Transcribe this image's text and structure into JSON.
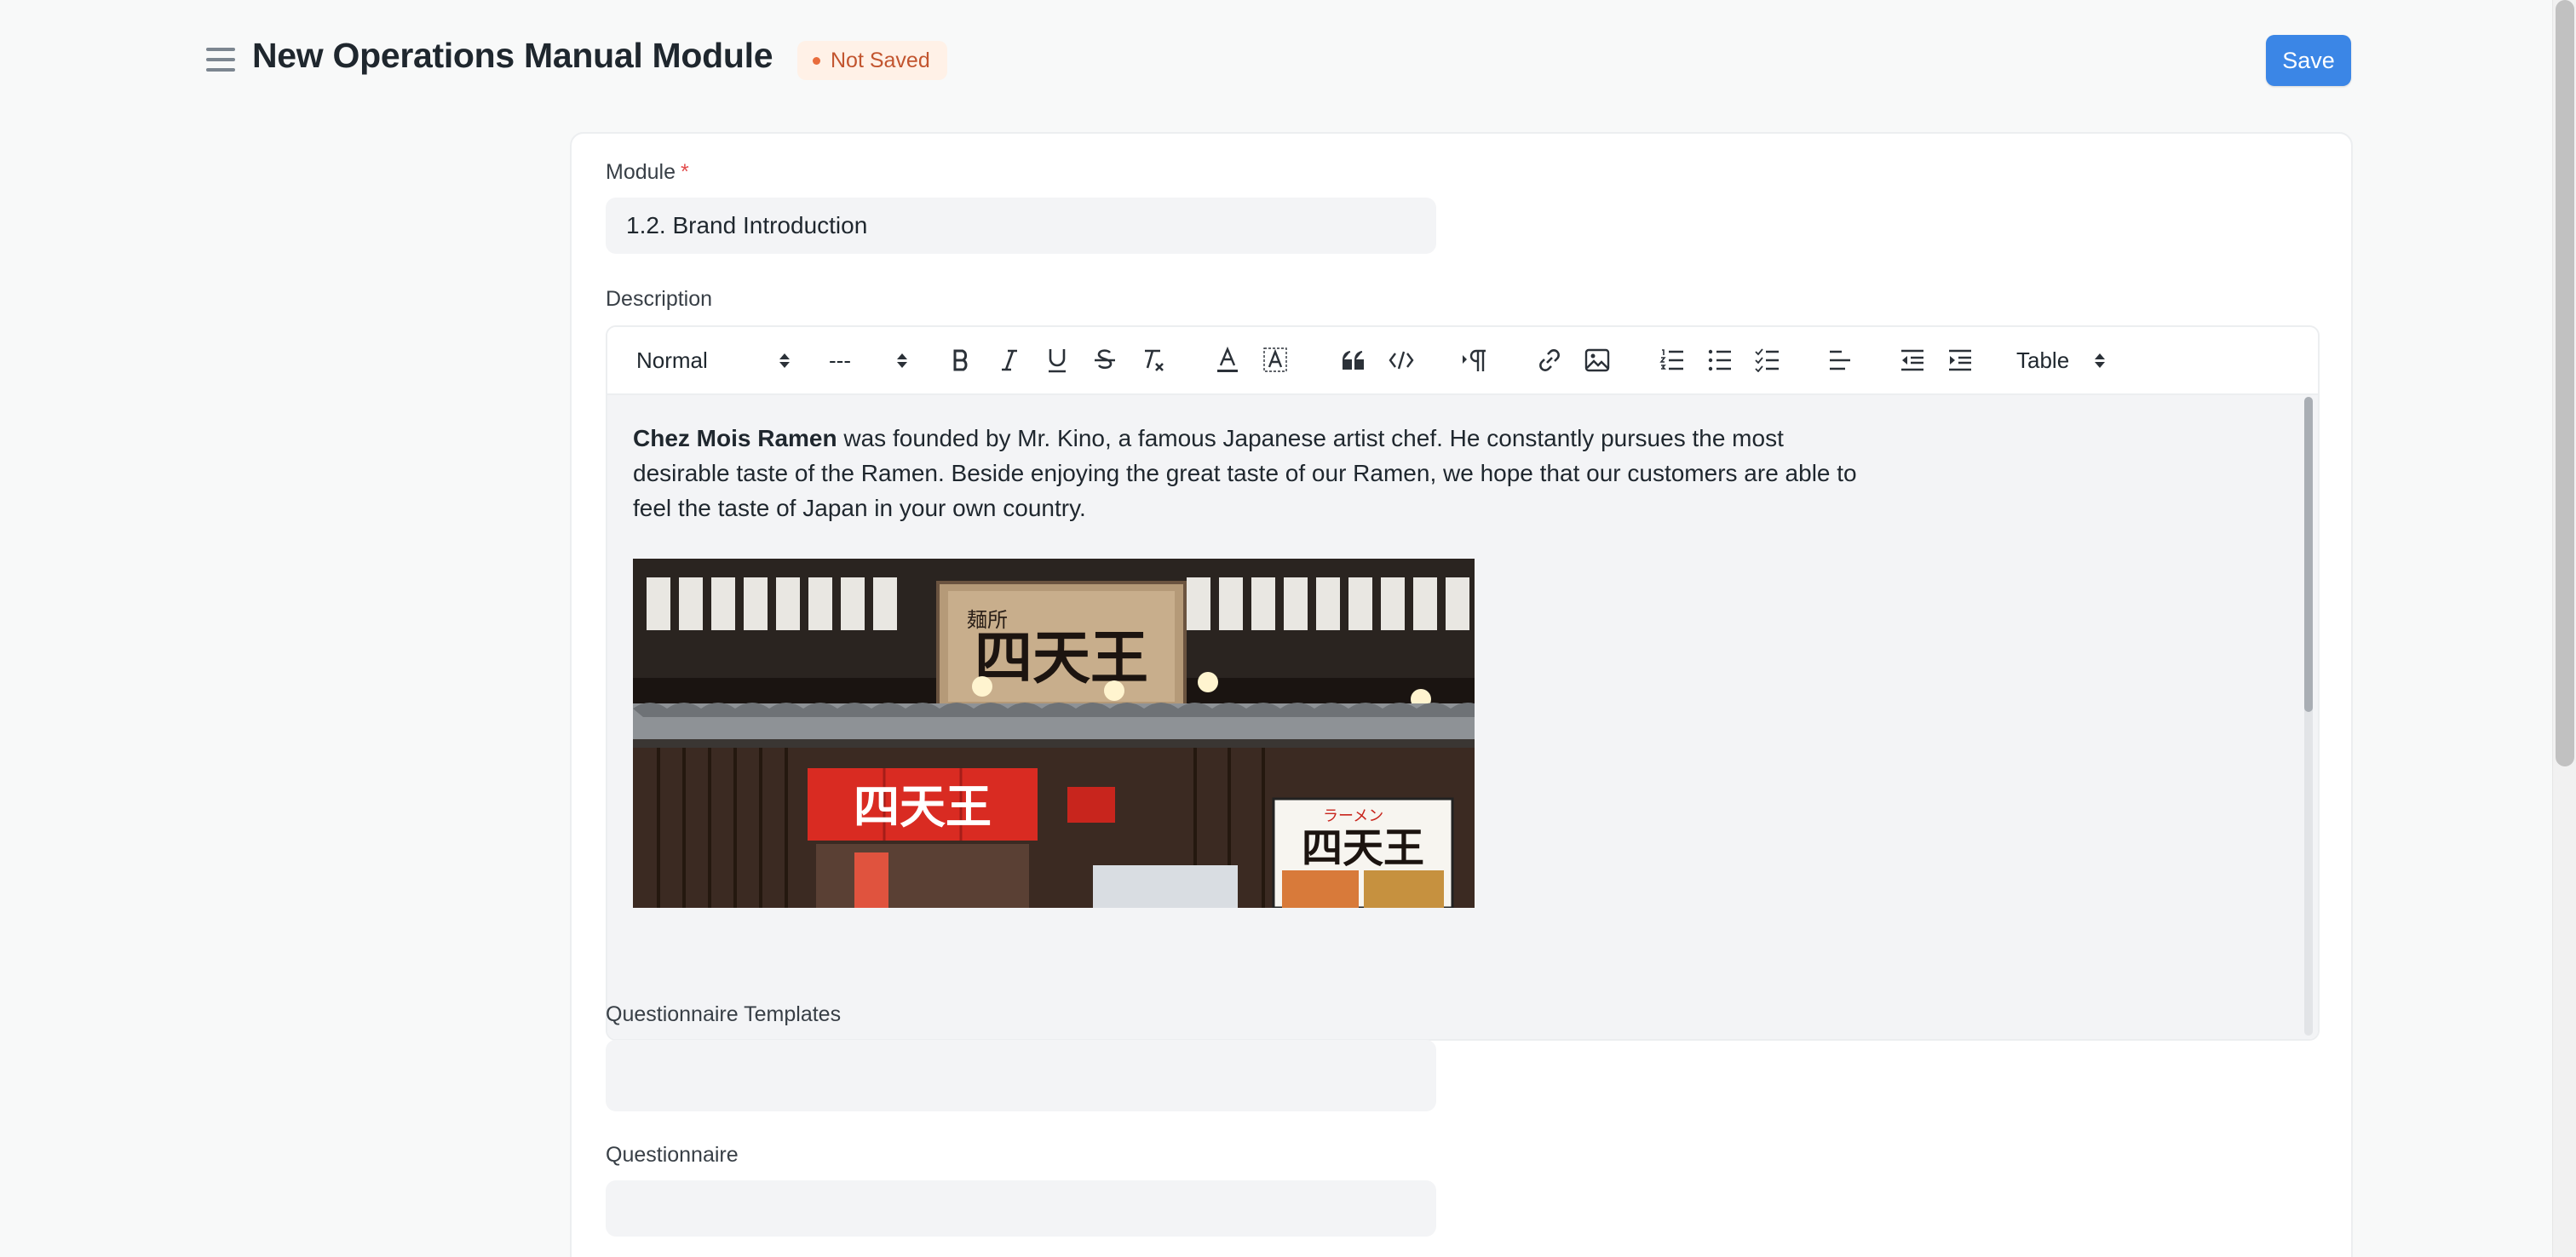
{
  "header": {
    "title": "New Operations Manual Module",
    "status": "Not Saved",
    "save_label": "Save"
  },
  "form": {
    "module": {
      "label": "Module",
      "required_mark": "*",
      "value": "1.2. Brand Introduction"
    },
    "description": {
      "label": "Description",
      "toolbar": {
        "heading_select": "Normal",
        "size_select": "---",
        "table_select": "Table",
        "tools": [
          "bold-icon",
          "italic-icon",
          "underline-icon",
          "strikethrough-icon",
          "clear-format-icon",
          "text-color-icon",
          "background-color-icon",
          "blockquote-icon",
          "code-block-icon",
          "text-direction-icon",
          "link-icon",
          "image-icon",
          "ordered-list-icon",
          "bullet-list-icon",
          "check-list-icon",
          "align-icon",
          "outdent-icon",
          "indent-icon"
        ]
      },
      "content": {
        "bold_lead": "Chez Mois Ramen",
        "body": " was founded by Mr. Kino, a famous Japanese artist chef. He constantly pursues the most desirable taste of the Ramen. Beside enjoying the great taste of our Ramen, we hope that our customers are able to feel the taste of Japan in your own country."
      },
      "image": {
        "sign_main": "四天王",
        "sign_small": "麺所",
        "curtain": "四天王",
        "board_top": "ラーメン",
        "board_main": "四天王"
      }
    },
    "questionnaire_templates": {
      "label": "Questionnaire Templates",
      "value": ""
    },
    "questionnaire": {
      "label": "Questionnaire",
      "value": ""
    }
  },
  "colors": {
    "accent": "#3b86e6",
    "status_text": "#c2552f",
    "status_bg": "#fff1e7",
    "required": "#e24c4c"
  }
}
